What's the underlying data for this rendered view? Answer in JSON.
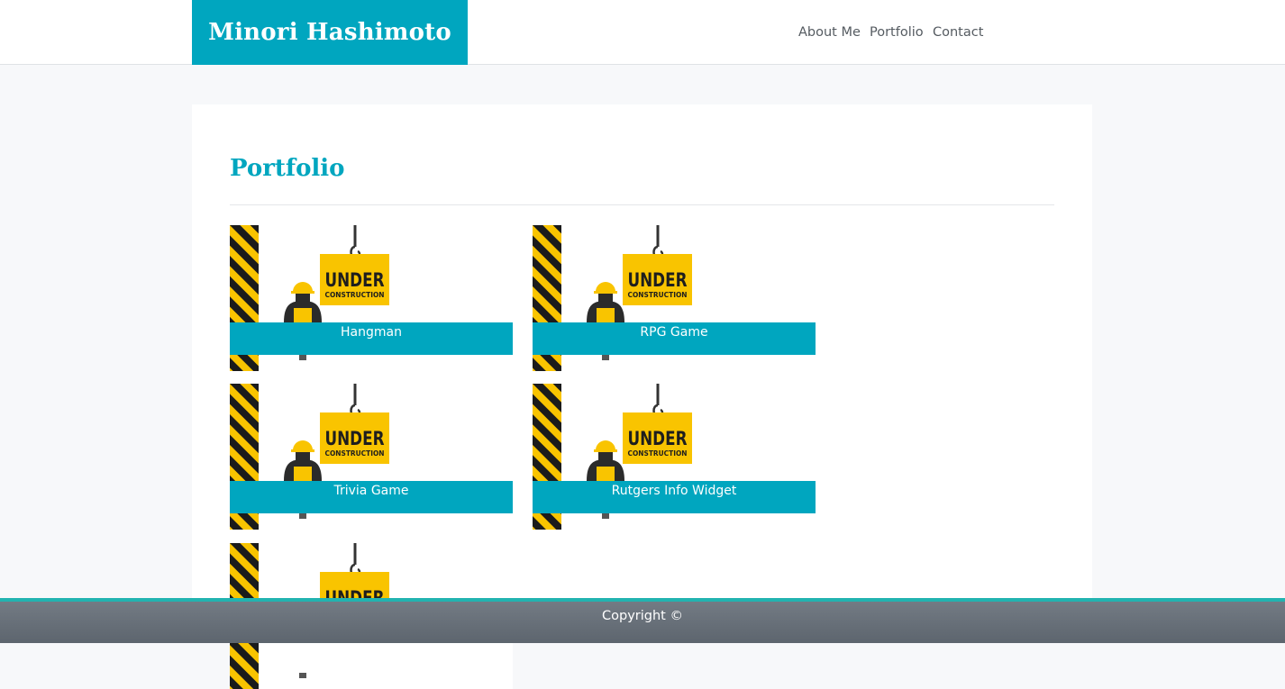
{
  "header": {
    "brand": "Minori Hashimoto",
    "nav": [
      "About Me",
      "Portfolio",
      "Contact"
    ]
  },
  "main": {
    "title": "Portfolio",
    "projects": [
      "Hangman",
      "RPG Game",
      "Trivia Game",
      "Rutgers Info Widget"
    ],
    "placeholder_sign": {
      "word": "UNDER",
      "subword": "CONSTRUCTION"
    }
  },
  "footer": {
    "text": "Copyright ©"
  },
  "colors": {
    "accent": "#00a6bf",
    "footer_top": "#22b3b0",
    "sign_yellow": "#f9c400"
  }
}
